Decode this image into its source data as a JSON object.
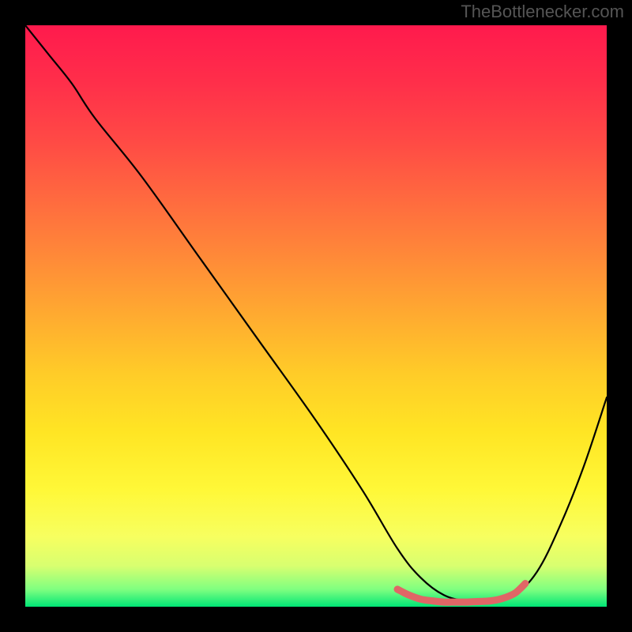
{
  "attribution": "TheBottlenecker.com",
  "chart_data": {
    "type": "line",
    "title": "",
    "xlabel": "",
    "ylabel": "",
    "xlim": [
      0,
      100
    ],
    "ylim": [
      0,
      100
    ],
    "series": [
      {
        "name": "bottleneck-curve",
        "x": [
          0,
          4,
          8,
          12,
          20,
          30,
          40,
          50,
          58,
          64,
          68,
          72,
          76,
          80,
          84,
          88,
          92,
          96,
          100
        ],
        "y": [
          100,
          95,
          90,
          84,
          74,
          60,
          46,
          32,
          20,
          10,
          5,
          2,
          1,
          1,
          2,
          6,
          14,
          24,
          36
        ],
        "color": "#000000",
        "width": 2.2
      },
      {
        "name": "optimal-zone-marker",
        "x": [
          64,
          66,
          68,
          70,
          72,
          74,
          76,
          78,
          80,
          82,
          84,
          85,
          86
        ],
        "y": [
          3.0,
          2.0,
          1.3,
          1.0,
          0.8,
          0.8,
          0.8,
          0.9,
          1.0,
          1.4,
          2.2,
          3.0,
          4.0
        ],
        "color": "#e06666",
        "width": 9
      }
    ],
    "background_gradient": {
      "stops": [
        {
          "offset": 0.0,
          "color": "#ff1a4d"
        },
        {
          "offset": 0.1,
          "color": "#ff2f4a"
        },
        {
          "offset": 0.2,
          "color": "#ff4a45"
        },
        {
          "offset": 0.3,
          "color": "#ff6a3f"
        },
        {
          "offset": 0.4,
          "color": "#ff8a38"
        },
        {
          "offset": 0.5,
          "color": "#ffab30"
        },
        {
          "offset": 0.6,
          "color": "#ffcc28"
        },
        {
          "offset": 0.7,
          "color": "#ffe524"
        },
        {
          "offset": 0.8,
          "color": "#fff838"
        },
        {
          "offset": 0.88,
          "color": "#f7ff60"
        },
        {
          "offset": 0.93,
          "color": "#d8ff70"
        },
        {
          "offset": 0.97,
          "color": "#80ff80"
        },
        {
          "offset": 1.0,
          "color": "#00e676"
        }
      ]
    }
  }
}
